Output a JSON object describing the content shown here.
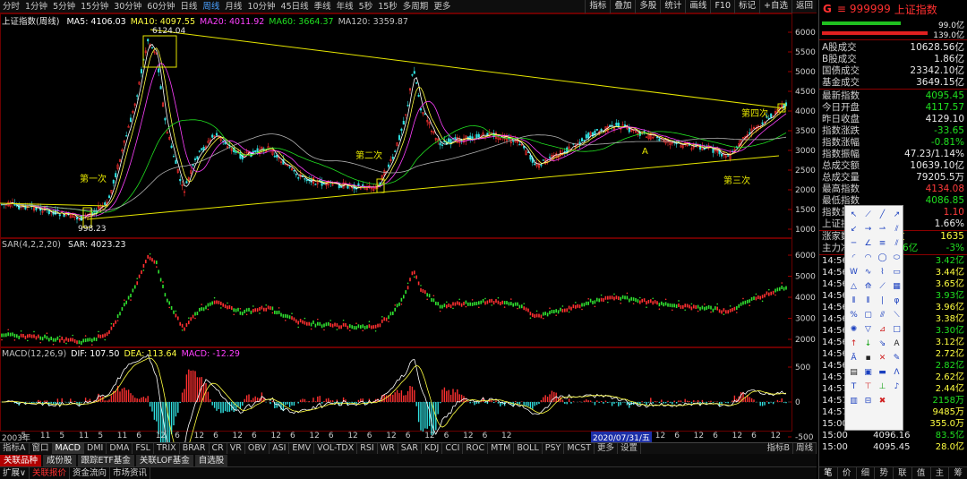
{
  "toolbar": {
    "timeframes": [
      "分时",
      "1分钟",
      "5分钟",
      "15分钟",
      "30分钟",
      "60分钟",
      "日线",
      "周线",
      "月线",
      "10分钟",
      "45日线",
      "季线",
      "年线",
      "5秒",
      "15秒",
      "多周期",
      "更多"
    ],
    "active_timeframe": "周线",
    "tools": [
      "指标",
      "叠加",
      "多股",
      "统计",
      "画线",
      "F10",
      "标记",
      "+自选",
      "返回"
    ]
  },
  "main_chart": {
    "title": "上证指数(周线)",
    "ma": [
      {
        "label": "MA5: 4106.03",
        "color": "#ffffff"
      },
      {
        "label": "MA10: 4097.55",
        "color": "#ffff40"
      },
      {
        "label": "MA20: 4011.92",
        "color": "#ff40ff"
      },
      {
        "label": "MA60: 3664.37",
        "color": "#20e020"
      },
      {
        "label": "MA120: 3359.87",
        "color": "#c0c0c0"
      }
    ],
    "y_ticks": [
      "6000",
      "5500",
      "5000",
      "4500",
      "4000",
      "3500",
      "3000",
      "2500",
      "2000",
      "1500",
      "1000"
    ],
    "high_label": "6124.04",
    "low_label": "998.23",
    "annotations": [
      "第一次",
      "第二次",
      "第三次",
      "第四次",
      "A"
    ]
  },
  "sar_panel": {
    "legend": [
      "SAR(4,2,2,20)",
      "SAR: 4023.23"
    ],
    "y_ticks": [
      "6000",
      "5000",
      "4000",
      "3000",
      "2000"
    ]
  },
  "macd_panel": {
    "legend": [
      {
        "label": "MACD(12,26,9)",
        "color": "#c0c0c0"
      },
      {
        "label": "DIF: 107.50",
        "color": "#ffffff"
      },
      {
        "label": "DEA: 113.64",
        "color": "#ffff40"
      },
      {
        "label": "MACD: -12.29",
        "color": "#ff40ff"
      }
    ],
    "y_ticks": [
      "500",
      "0",
      "-500"
    ]
  },
  "x_axis": {
    "labels": [
      "2003年",
      "5",
      "11",
      "5",
      "11",
      "5",
      "11",
      "6",
      "12",
      "6",
      "12",
      "6",
      "12",
      "6",
      "12",
      "6",
      "12",
      "6",
      "12",
      "6",
      "12",
      "6",
      "12",
      "6",
      "12",
      "6",
      "12",
      "6",
      "12",
      "6",
      "12",
      "6",
      "12",
      "6",
      "12",
      "6",
      "12",
      "6",
      "12",
      "6",
      "12"
    ],
    "selected_date": "2020/07/31/五"
  },
  "indicator_bar": {
    "items": [
      "指标A",
      "窗口",
      "MACD",
      "DMI",
      "DMA",
      "FSL",
      "TRIX",
      "BRAR",
      "CR",
      "VR",
      "OBV",
      "ASI",
      "EMV",
      "VOL-TDX",
      "RSI",
      "WR",
      "SAR",
      "KDJ",
      "CCI",
      "ROC",
      "MTM",
      "BOLL",
      "PSY",
      "MCST",
      "更多",
      "设置"
    ],
    "active": "MACD",
    "right": [
      "指标B",
      "周线"
    ]
  },
  "tabs": {
    "items": [
      "关联品种",
      "成份股",
      "跟踪ETF基金",
      "关联LOF基金",
      "自选股"
    ],
    "active": "关联品种"
  },
  "status_bar": [
    "扩展∨",
    "关联报价",
    "资金流向",
    "市场资讯"
  ],
  "quote_panel": {
    "code": "999999",
    "name": "上证指数",
    "bars": [
      {
        "label": "99.0亿"
      },
      {
        "label": "139.0亿"
      }
    ],
    "rows_a": [
      {
        "k": "A股成交",
        "v": "10628.56亿",
        "c": "wh"
      },
      {
        "k": "B股成交",
        "v": "1.86亿",
        "c": "wh"
      },
      {
        "k": "国债成交",
        "v": "23342.10亿",
        "c": "wh"
      },
      {
        "k": "基金成交",
        "v": "3649.15亿",
        "c": "wh"
      }
    ],
    "rows_b": [
      {
        "k": "最新指数",
        "v": "4095.45",
        "c": "dn"
      },
      {
        "k": "今日开盘",
        "v": "4117.57",
        "c": "dn"
      },
      {
        "k": "昨日收盘",
        "v": "4129.10",
        "c": "wh"
      },
      {
        "k": "指数涨跌",
        "v": "-33.65",
        "c": "dn"
      },
      {
        "k": "指数涨幅",
        "v": "-0.81%",
        "c": "dn"
      },
      {
        "k": "指数振幅",
        "v": "47.23/1.14%",
        "c": "wh"
      },
      {
        "k": "总成交额",
        "v": "10639.10亿",
        "c": "wh"
      },
      {
        "k": "总成交量",
        "v": "79205.5万",
        "c": "wh"
      },
      {
        "k": "最高指数",
        "v": "4134.08",
        "c": "up"
      },
      {
        "k": "最低指数",
        "v": "4086.85",
        "c": "dn"
      },
      {
        "k": "指数量比",
        "v": "1.10",
        "c": "up"
      },
      {
        "k": "上证换手",
        "v": "1.66%",
        "c": "wh"
      }
    ],
    "rows_c": [
      {
        "k": "涨家数",
        "v": "家数",
        "v2": "1635",
        "c": "ye"
      },
      {
        "k": "主力净",
        "v": "-316.6亿",
        "v2": "-3%",
        "c": "dn"
      }
    ],
    "ticks": [
      {
        "t": "14:56",
        "p": "",
        "v": "3.42亿"
      },
      {
        "t": "14:56",
        "p": "",
        "v": "3.44亿"
      },
      {
        "t": "14:56",
        "p": "",
        "v": "3.65亿"
      },
      {
        "t": "14:56",
        "p": "",
        "v": "3.93亿"
      },
      {
        "t": "14:56",
        "p": "",
        "v": "3.96亿"
      },
      {
        "t": "14:56",
        "p": "",
        "v": "3.38亿"
      },
      {
        "t": "14:56",
        "p": "",
        "v": "3.30亿"
      },
      {
        "t": "14:56",
        "p": "",
        "v": "3.12亿"
      },
      {
        "t": "14:56",
        "p": "",
        "v": "2.72亿"
      },
      {
        "t": "14:56",
        "p": "",
        "v": "2.82亿"
      },
      {
        "t": "14:57",
        "p": "",
        "v": "2.62亿"
      },
      {
        "t": "14:57",
        "p": "",
        "v": "2.44亿"
      },
      {
        "t": "14:57",
        "p": "",
        "v": "2158万"
      },
      {
        "t": "14:57",
        "p": "",
        "v": "9485万"
      },
      {
        "t": "15:00",
        "p": "",
        "v": "355.0万"
      },
      {
        "t": "15:00",
        "p": "4096.16",
        "v": "83.5亿"
      },
      {
        "t": "15:00",
        "p": "4095.45",
        "v": "28.0亿"
      }
    ],
    "tabs": [
      "笔",
      "价",
      "细",
      "势",
      "联",
      "值",
      "主",
      "筹"
    ],
    "active_tab": "笔"
  },
  "draw_tools": [
    "select-arrow",
    "line-segment",
    "line",
    "ray",
    "ray-down",
    "ray-right",
    "arrow-line",
    "parallel-line",
    "price-line",
    "angle-line",
    "fib-line",
    "channel",
    "arc",
    "circle-arc",
    "circle",
    "ellipse",
    "wave",
    "zigzag",
    "polyline",
    "rectangle",
    "triangle",
    "gann-fan",
    "speed-line",
    "gann-grid",
    "period-line",
    "fib-period",
    "cycle-line",
    "golden-ratio",
    "percent-line",
    "box",
    "trend-channel",
    "regression",
    "fan",
    "triangle-down",
    "triangle-flag",
    "rect-box",
    "arrow-up",
    "arrow-down",
    "arrow-mark",
    "text-A",
    "text-A2",
    "gray-box",
    "cross-x",
    "paint",
    "doc",
    "rect-frame",
    "screen",
    "triangle-lines",
    "text-tool",
    "text-up",
    "text-down",
    "note",
    "calendar",
    "mirror",
    "delete"
  ]
}
